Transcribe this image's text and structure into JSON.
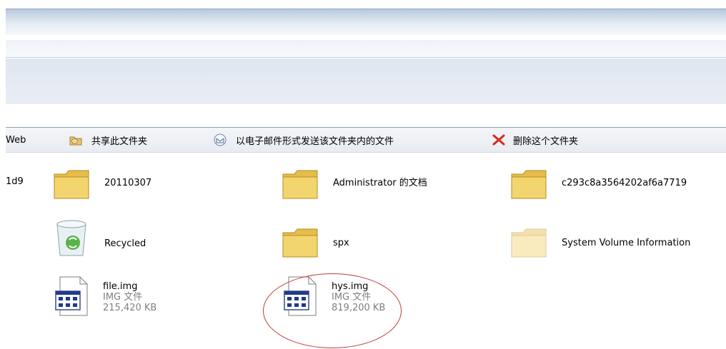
{
  "tasks": {
    "web_label": "Web",
    "share_label": "共享此文件夹",
    "email_label": "以电子邮件形式发送该文件夹内的文件",
    "delete_label": "删除这个文件夹"
  },
  "address_fragment": "1d9",
  "items": {
    "folder_20110307": "20110307",
    "folder_admin": "Administrator 的文档",
    "folder_hash": "c293c8a3564202af6a7719",
    "recycled": "Recycled",
    "folder_spx": "spx",
    "folder_svi": "System Volume Information",
    "file_img": {
      "name": "file.img",
      "type": "IMG 文件",
      "size": "215,420 KB"
    },
    "hys_img": {
      "name": "hys.img",
      "type": "IMG 文件",
      "size": "819,200 KB"
    }
  },
  "colors": {
    "folder_fill": "#f1d36b",
    "annotation": "#c23a3a",
    "delete_x": "#d42a1a"
  }
}
